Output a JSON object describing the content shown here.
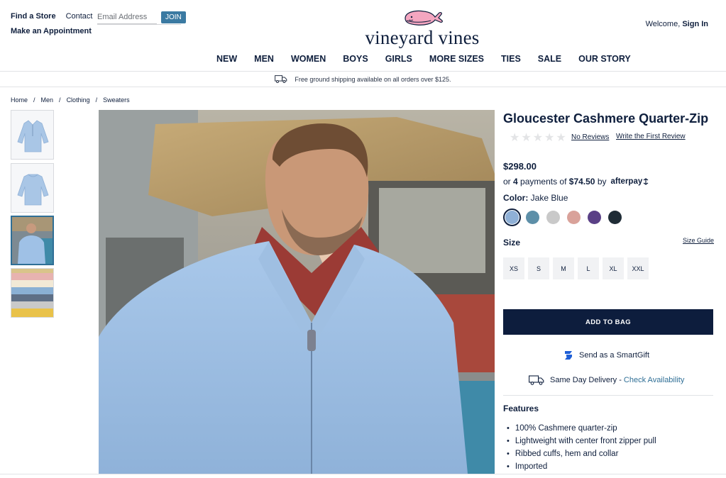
{
  "header": {
    "find_store": "Find a Store",
    "contact": "Contact",
    "email_placeholder": "Email Address",
    "join": "JOIN",
    "appointment": "Make an Appointment",
    "logo_text": "vineyard vines",
    "welcome_prefix": "Welcome,",
    "sign_in": "Sign In"
  },
  "nav": {
    "items": [
      "NEW",
      "MEN",
      "WOMEN",
      "BOYS",
      "GIRLS",
      "MORE SIZES",
      "TIES",
      "SALE",
      "OUR STORY"
    ]
  },
  "promo": {
    "shipping": "Free ground shipping available on all orders over $125."
  },
  "breadcrumb": {
    "items": [
      "Home",
      "Men",
      "Clothing",
      "Sweaters"
    ],
    "separator": "/"
  },
  "product": {
    "title": "Gloucester Cashmere Quarter-Zip",
    "rating_stars": 0,
    "no_reviews": "No Reviews",
    "write_review": "Write the First Review",
    "price": "$298.00",
    "afterpay_prefix": "or",
    "afterpay_count": "4",
    "afterpay_mid": "payments of",
    "afterpay_amount": "$74.50",
    "afterpay_by": "by",
    "afterpay_brand": "afterpay",
    "color_label": "Color:",
    "color_value": "Jake Blue",
    "swatch_colors": [
      "#8fb0d6",
      "#5d8fa8",
      "#c9c9c9",
      "#d9a29a",
      "#5a4086",
      "#1f2c36"
    ],
    "size_label": "Size",
    "size_guide": "Size Guide",
    "sizes": [
      "XS",
      "S",
      "M",
      "L",
      "XL",
      "XXL"
    ],
    "add_to_bag": "ADD TO BAG",
    "smartgift": "Send as a SmartGift",
    "sameday_label": "Same Day Delivery -",
    "sameday_link": "Check Availability",
    "features_title": "Features",
    "features": [
      "100% Cashmere quarter-zip",
      "Lightweight with center front zipper pull",
      "Ribbed cuffs, hem and collar",
      "Imported"
    ]
  },
  "colors": {
    "navy": "#0f1f3d",
    "accent_blue": "#2f6f96",
    "join_blue": "#3b7aa2",
    "whale_pink": "#f4a6c0"
  }
}
